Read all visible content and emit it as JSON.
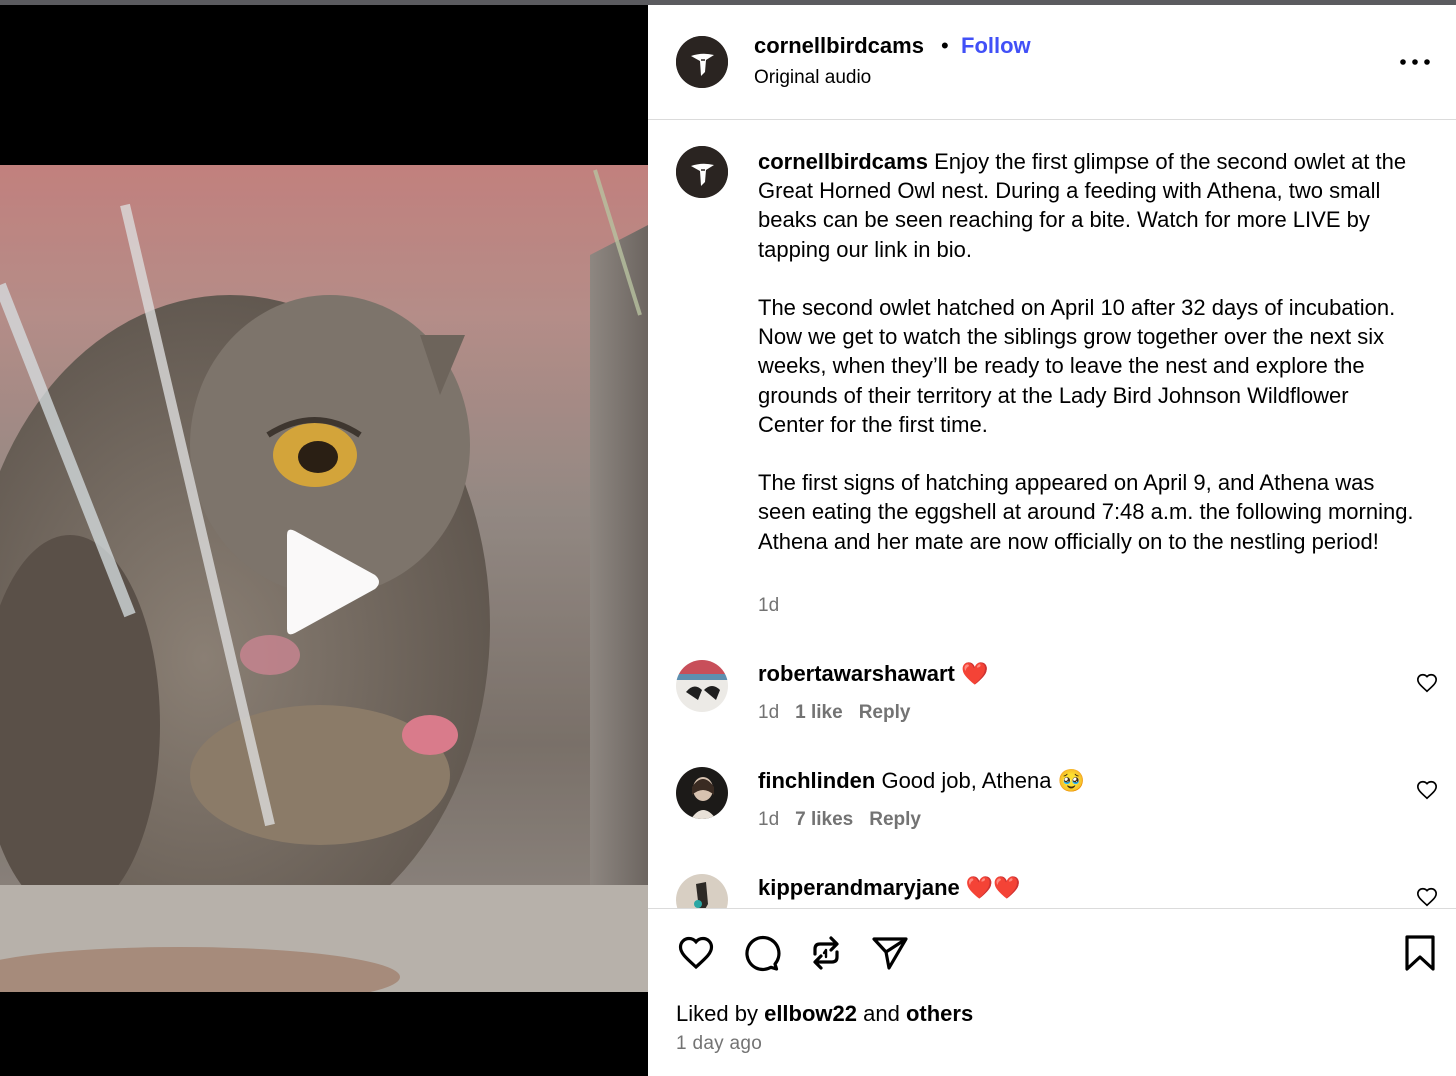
{
  "post": {
    "username": "cornellbirdcams",
    "follow_label": "Follow",
    "separator": "•",
    "audio": "Original audio",
    "caption": "Enjoy the first glimpse of the second owlet at the Great Horned Owl nest. During a feeding with Athena, two small beaks can be seen reaching for a bite. Watch for more LIVE by tapping our link in bio.\n\nThe second owlet hatched on April 10 after 32 days of incubation. Now we get to watch the siblings grow together over the next six weeks, when they’ll be ready to leave the nest and explore the grounds of their territory at the Lady Bird Johnson Wildflower Center for the first time.\n\nThe first signs of hatching appeared on April 9, and Athena was seen eating the eggshell at around 7:48 a.m. the following morning. Athena and her mate are now officially on to the nestling period!",
    "time": "1d"
  },
  "comments": [
    {
      "username": "robertawarshawart",
      "text": "",
      "emoji": "❤️",
      "time": "1d",
      "likes": "1 like",
      "reply": "Reply"
    },
    {
      "username": "finchlinden",
      "text": "Good job, Athena",
      "emoji": "🥹",
      "time": "1d",
      "likes": "7 likes",
      "reply": "Reply"
    },
    {
      "username": "kipperandmaryjane",
      "text": "",
      "emoji": "❤️❤️",
      "time": "",
      "likes": "",
      "reply": ""
    }
  ],
  "footer": {
    "liked_prefix": "Liked by",
    "liked_user": "ellbow22",
    "liked_and": "and",
    "liked_others": "others",
    "time_ago": "1 day ago"
  },
  "icons": {
    "play": "play-icon",
    "more": "more-options-icon",
    "like": "heart-icon",
    "comment": "comment-icon",
    "repost": "repost-icon",
    "share": "send-icon",
    "save": "bookmark-icon"
  },
  "colors": {
    "follow": "#4150f7",
    "muted": "#737373",
    "heart": "#ed1c24"
  }
}
